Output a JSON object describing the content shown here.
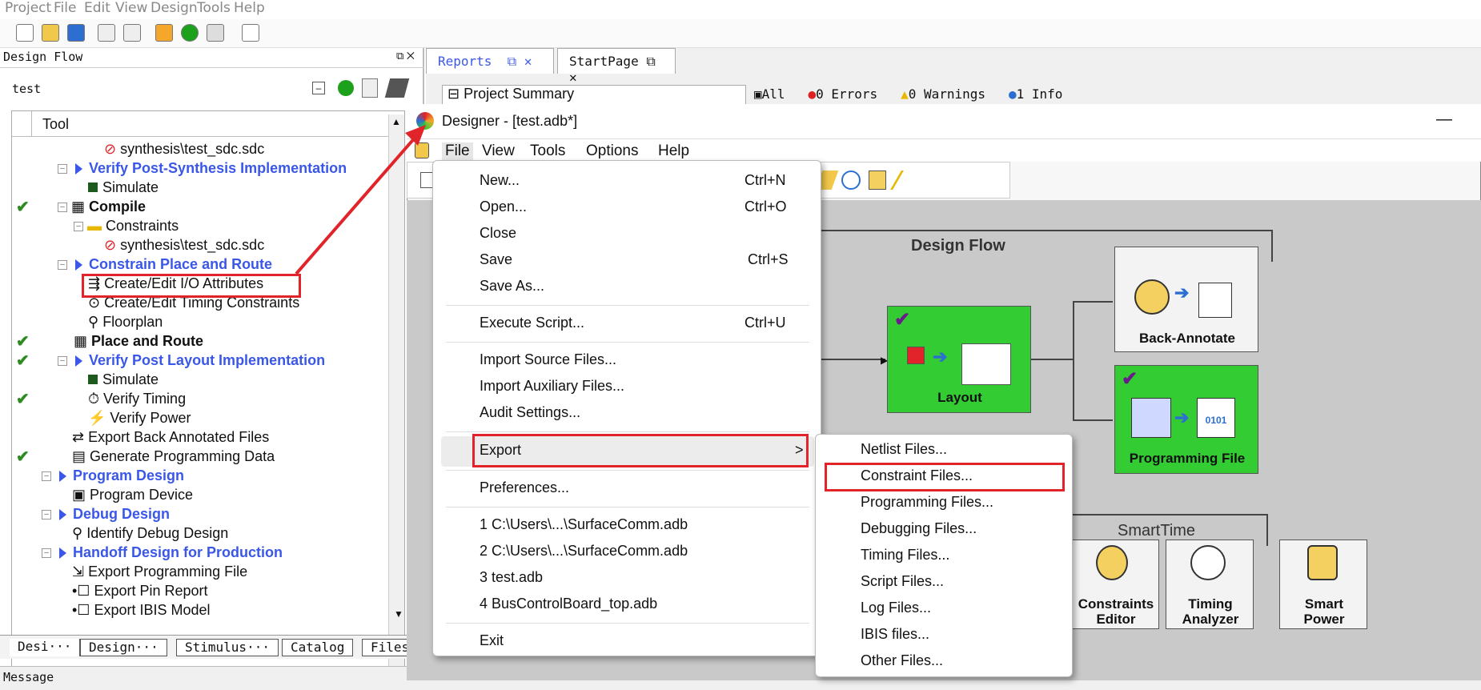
{
  "menubar": {
    "items": [
      "Project",
      "File",
      "Edit",
      "View",
      "Design",
      "Tools",
      "Help"
    ]
  },
  "left_panel": {
    "header": "Design Flow",
    "project": "test",
    "column_header": "Tool",
    "rows": [
      {
        "label": "synthesis\\test_sdc.sdc"
      },
      {
        "label": "Verify Post-Synthesis Implementation"
      },
      {
        "label": "Simulate"
      },
      {
        "label": "Compile"
      },
      {
        "label": "Constraints"
      },
      {
        "label": "synthesis\\test_sdc.sdc"
      },
      {
        "label": "Constrain Place and Route"
      },
      {
        "label": "Create/Edit I/O Attributes"
      },
      {
        "label": "Create/Edit Timing Constraints"
      },
      {
        "label": "Floorplan"
      },
      {
        "label": "Place and Route"
      },
      {
        "label": "Verify Post Layout Implementation"
      },
      {
        "label": "Simulate"
      },
      {
        "label": "Verify Timing"
      },
      {
        "label": "Verify Power"
      },
      {
        "label": "Export Back Annotated Files"
      },
      {
        "label": "Generate Programming Data"
      },
      {
        "label": "Program Design"
      },
      {
        "label": "Program Device"
      },
      {
        "label": "Debug Design"
      },
      {
        "label": "Identify Debug Design"
      },
      {
        "label": "Handoff Design for Production"
      },
      {
        "label": "Export Programming File"
      },
      {
        "label": "Export Pin Report"
      },
      {
        "label": "Export IBIS Model"
      }
    ],
    "bottom_tabs": [
      "Desi···",
      "Design···",
      "Stimulus···",
      "Catalog",
      "Files"
    ]
  },
  "status": {
    "message": "Message"
  },
  "reports": {
    "tabs": [
      "Reports",
      "StartPage"
    ],
    "summary": "Project Summary",
    "filters": {
      "all": "All",
      "errors": "0 Errors",
      "warnings": "0 Warnings",
      "info": "1 Info"
    }
  },
  "designer": {
    "title": "Designer - [test.adb*]",
    "minimize": "—",
    "menu": [
      "File",
      "View",
      "Tools",
      "Options",
      "Help"
    ],
    "flow": {
      "design_flow_title": "Design Flow",
      "layout": "Layout",
      "back_annotate": "Back-Annotate",
      "programming_file": "Programming File",
      "smarttime_title": "SmartTime",
      "constraints_editor_l1": "Constraints",
      "constraints_editor_l2": "Editor",
      "timing_analyzer_l1": "Timing",
      "timing_analyzer_l2": "Analyzer",
      "smart_power_l1": "Smart",
      "smart_power_l2": "Power",
      "prog_bits": "0101"
    }
  },
  "file_menu": {
    "items": [
      {
        "label": "New...",
        "shortcut": "Ctrl+N"
      },
      {
        "label": "Open...",
        "shortcut": "Ctrl+O"
      },
      {
        "label": "Close",
        "shortcut": ""
      },
      {
        "label": "Save",
        "shortcut": "Ctrl+S"
      },
      {
        "label": "Save As...",
        "shortcut": ""
      },
      {
        "label": "Execute Script...",
        "shortcut": "Ctrl+U"
      },
      {
        "label": "Import Source Files...",
        "shortcut": ""
      },
      {
        "label": "Import Auxiliary Files...",
        "shortcut": ""
      },
      {
        "label": "Audit Settings...",
        "shortcut": ""
      },
      {
        "label": "Export",
        "shortcut": ">"
      },
      {
        "label": "Preferences...",
        "shortcut": ""
      },
      {
        "label": "1 C:\\Users\\...\\SurfaceComm.adb",
        "shortcut": ""
      },
      {
        "label": "2 C:\\Users\\...\\SurfaceComm.adb",
        "shortcut": ""
      },
      {
        "label": "3 test.adb",
        "shortcut": ""
      },
      {
        "label": "4 BusControlBoard_top.adb",
        "shortcut": ""
      },
      {
        "label": "Exit",
        "shortcut": ""
      }
    ]
  },
  "export_submenu": {
    "items": [
      "Netlist Files...",
      "Constraint Files...",
      "Programming Files...",
      "Debugging Files...",
      "Timing Files...",
      "Script Files...",
      "Log Files...",
      "IBIS files...",
      "Other Files..."
    ]
  },
  "colors": {
    "highlight_red": "#e0242a",
    "green_box": "#33cc33",
    "link_blue": "#3a57e8"
  }
}
